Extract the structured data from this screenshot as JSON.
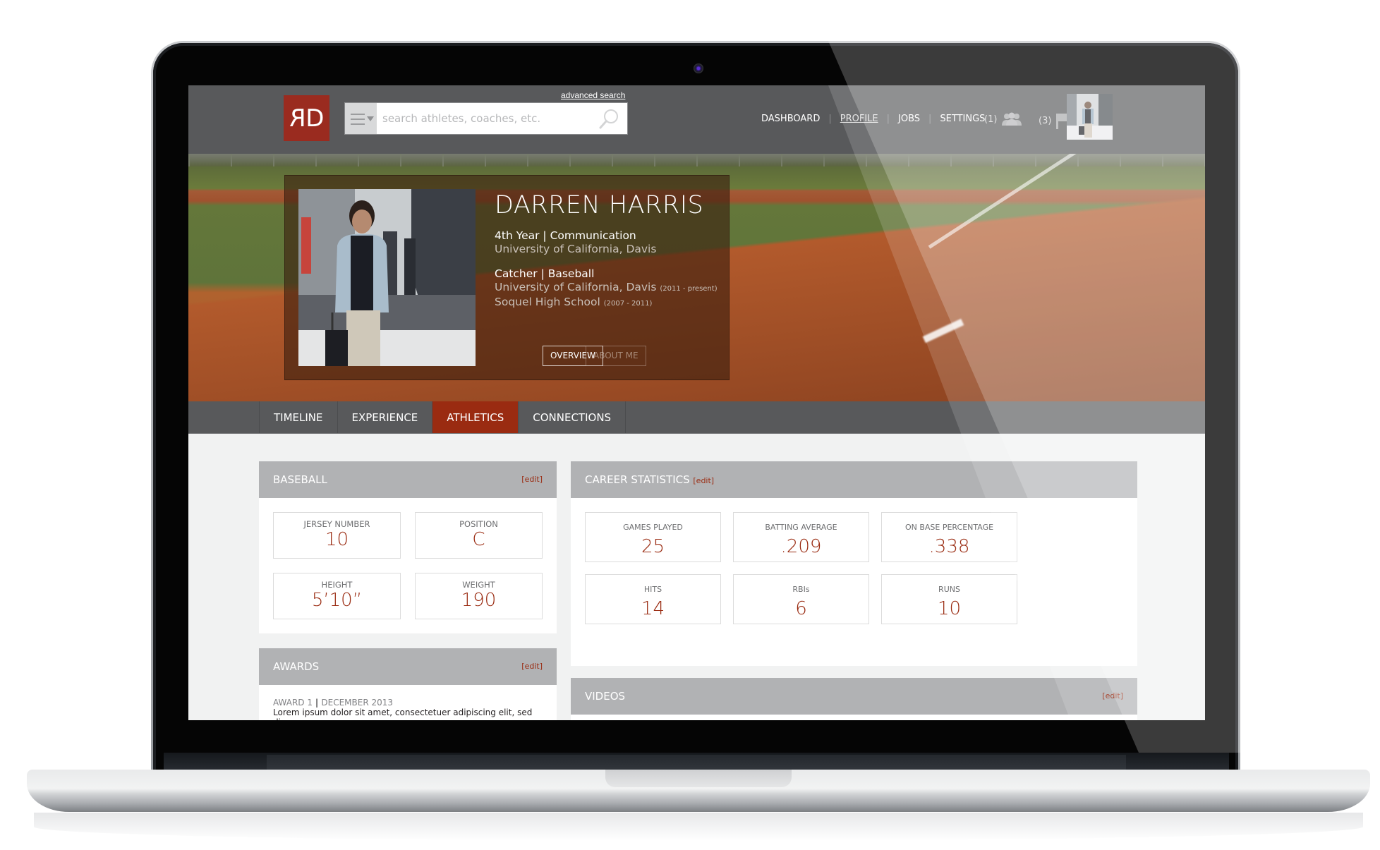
{
  "header": {
    "logo_text": "RD",
    "advanced_search_label": "advanced search",
    "search_placeholder": "search athletes, coaches, etc.",
    "nav": [
      {
        "label": "DASHBOARD",
        "active": false
      },
      {
        "label": "PROFILE",
        "active": true
      },
      {
        "label": "JOBS",
        "active": false
      },
      {
        "label": "SETTINGS",
        "active": false
      }
    ],
    "connection_requests_count": "(1)",
    "notifications_count": "(3)"
  },
  "profile": {
    "name": "DARREN HARRIS",
    "year_major": "4th Year | Communication",
    "school": "University of California, Davis",
    "position_sport": "Catcher | Baseball",
    "team_1": "University of California, Davis",
    "team_1_years": "(2011 - present)",
    "team_2": "Soquel High School",
    "team_2_years": "(2007 - 2011)",
    "buttons": {
      "overview": "OVERVIEW",
      "about_me": "ABOUT ME"
    }
  },
  "tabs": [
    {
      "label": "TIMELINE",
      "active": false
    },
    {
      "label": "EXPERIENCE",
      "active": false
    },
    {
      "label": "ATHLETICS",
      "active": true
    },
    {
      "label": "CONNECTIONS",
      "active": false
    }
  ],
  "baseball": {
    "title": "BASEBALL",
    "edit_label": "[edit]",
    "fields": [
      {
        "label": "JERSEY NUMBER",
        "value": "10"
      },
      {
        "label": "POSITION",
        "value": "C"
      },
      {
        "label": "HEIGHT",
        "value": "5’10”"
      },
      {
        "label": "WEIGHT",
        "value": "190"
      }
    ]
  },
  "awards": {
    "title": "AWARDS",
    "edit_label": "[edit]",
    "items": [
      {
        "title": "AWARD 1",
        "date": "DECEMBER 2013",
        "description": "Lorem ipsum dolor sit amet, consectetuer adipiscing elit, sed diam"
      }
    ]
  },
  "career_statistics": {
    "title": "CAREER STATISTICS",
    "edit_label": "[edit]",
    "stats": [
      {
        "label": "GAMES PLAYED",
        "value": "25"
      },
      {
        "label": "BATTING AVERAGE",
        "value": ".209"
      },
      {
        "label": "ON BASE PERCENTAGE",
        "value": ".338"
      },
      {
        "label": "HITS",
        "value": "14"
      },
      {
        "label": "RBIs",
        "value": "6"
      },
      {
        "label": "RUNS",
        "value": "10"
      }
    ]
  },
  "videos": {
    "title": "VIDEOS",
    "edit_label": "[edit]"
  },
  "colors": {
    "brand": "#9a2b1f",
    "accent": "#9a2b11",
    "header_bg": "#58595b",
    "card_header_bg": "#b1b2b4"
  }
}
